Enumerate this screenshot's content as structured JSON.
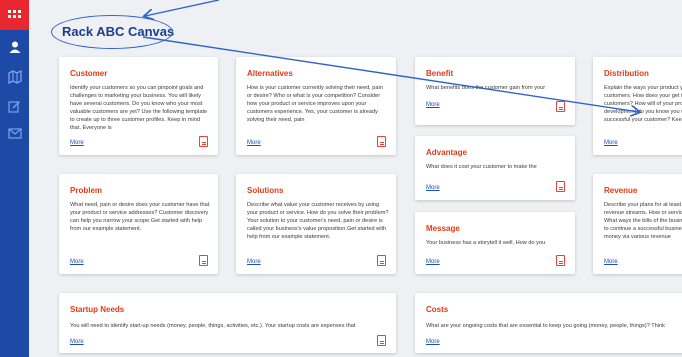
{
  "app": {
    "title": "Rack ABC Canvas"
  },
  "sidebar": {
    "items": [
      {
        "icon": "grid-icon"
      },
      {
        "icon": "user-icon"
      },
      {
        "icon": "map-icon"
      },
      {
        "icon": "edit-icon"
      },
      {
        "icon": "mail-icon"
      }
    ]
  },
  "cards": {
    "customer": {
      "title": "Customer",
      "body": "Identify your customers so you can pinpoint goals and challenges to marketing your business. You will likely have several customers. Do you know who your most valuable customers are yet? Use the following template to create up to three customer profiles. Keep in mind that, Everyone is",
      "more": "More"
    },
    "alternatives": {
      "title": "Alternatives",
      "body": "How is your customer currently solving their need, pain or desire? Who or what is your competition? Consider how your product or service improves upon your customers experience. Yes, your customer is already solving their need, pain",
      "more": "More"
    },
    "benefit": {
      "title": "Benefit",
      "body": "What benefits does the customer gain from your",
      "more": "More"
    },
    "distribution": {
      "title": "Distribution",
      "body": "Explain the ways your product your customers. How does your get to your customers? How will of your products development do you know you were successful your customer? Keep in mind",
      "more": "More"
    },
    "advantage": {
      "title": "Advantage",
      "body": "What does it cost your customer to make the",
      "more": "More"
    },
    "problem": {
      "title": "Problem",
      "body": "What need, pain or desire does your customer have that your product or service addresses? Customer discovery can help you narrow your scope.Get started with help from our example statement.",
      "more": "More"
    },
    "solutions": {
      "title": "Solutions",
      "body": "Describe what value your customer receives by using your product or service. How do you solve their problem? Your solution to your customer's need, pain or desire is called your business's value proposition.Get started with help from our example statement.",
      "more": "More"
    },
    "message": {
      "title": "Message",
      "body": "Your business has a storytell it well. How do you",
      "more": "More"
    },
    "revenue": {
      "title": "Revenue",
      "body": "Describe your plans for at least expected revenue streams. How or service priced? What ways the bills of the business? You to continue a successful business make money via various revenue",
      "more": "More"
    },
    "startup_needs": {
      "title": "Startup Needs",
      "body": "You will need to identify start-up needs (money, people, things, activities, etc.). Your startup costs are expenses that",
      "more": "More"
    },
    "costs": {
      "title": "Costs",
      "body": "What are your ongoing costs that are essential to keep you going (money, people, things)? Think",
      "more": "More"
    }
  },
  "colors": {
    "sidebar": "#1c4aa6",
    "sidebar_top": "#e8282e",
    "card_title": "#e23a16",
    "link": "#1d4fb0",
    "annotation": "#2f63c9"
  }
}
